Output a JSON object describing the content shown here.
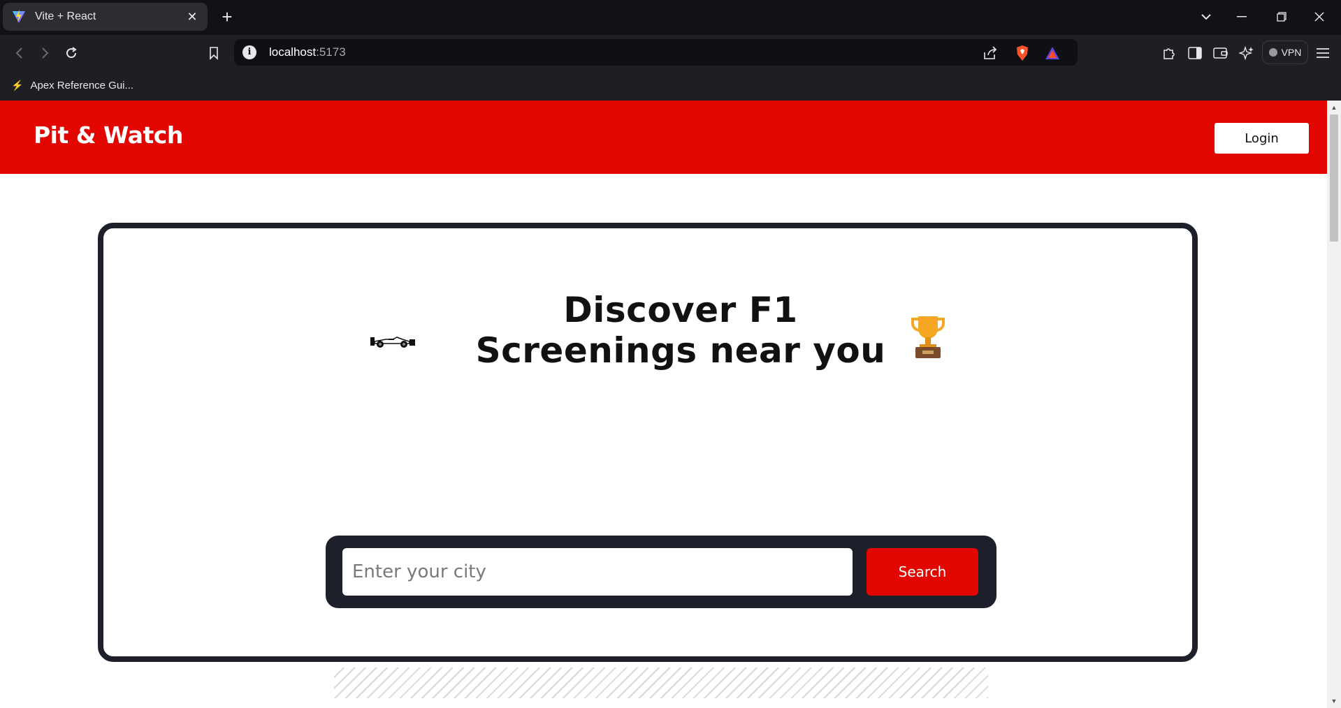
{
  "browser": {
    "tab_title": "Vite + React",
    "url_host": "localhost",
    "url_port": ":5173",
    "vpn_label": "VPN",
    "bookmark_label": "Apex Reference Gui..."
  },
  "site": {
    "brand": "Pit & Watch",
    "login_label": "Login"
  },
  "hero": {
    "title_line1": "Discover F1",
    "title_line2": "Screenings near you"
  },
  "search": {
    "placeholder": "Enter your city",
    "value": "",
    "button_label": "Search"
  },
  "colors": {
    "brand_red": "#e10600",
    "dark_navy": "#1d1f2b"
  }
}
